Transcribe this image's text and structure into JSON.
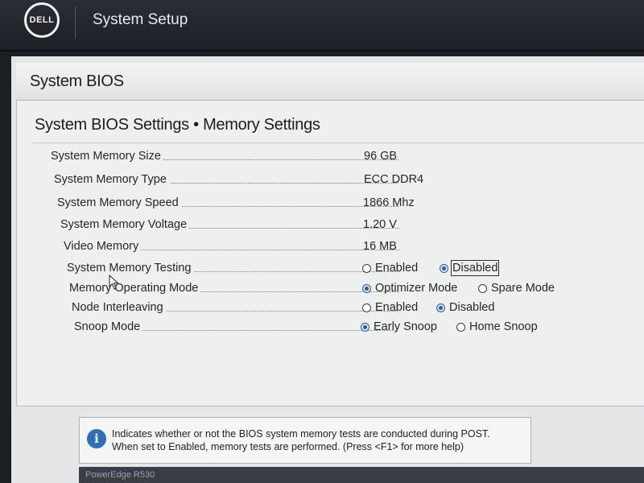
{
  "header": {
    "logo_text": "DELL",
    "app_title": "System Setup"
  },
  "bios": {
    "title": "System BIOS",
    "page_heading": "System BIOS Settings • Memory Settings"
  },
  "settings": [
    {
      "label": "System Memory Size",
      "value": "96 GB"
    },
    {
      "label": "System Memory Type",
      "value": "ECC DDR4"
    },
    {
      "label": "System Memory Speed",
      "value": "1866 Mhz"
    },
    {
      "label": "System Memory Voltage",
      "value": "1.20 V"
    },
    {
      "label": "Video Memory",
      "value": "16 MB"
    },
    {
      "label": "System Memory Testing",
      "options": [
        "Enabled",
        "Disabled"
      ],
      "selected": "Disabled"
    },
    {
      "label": "Memory Operating Mode",
      "options": [
        "Optimizer Mode",
        "Spare Mode"
      ],
      "selected": "Optimizer Mode"
    },
    {
      "label": "Node Interleaving",
      "options": [
        "Enabled",
        "Disabled"
      ],
      "selected": "Disabled"
    },
    {
      "label": "Snoop Mode",
      "options": [
        "Early Snoop",
        "Home Snoop"
      ],
      "selected": "Early Snoop"
    }
  ],
  "help": {
    "icon": "info-icon",
    "line1": "Indicates whether or not the BIOS system memory tests are conducted during POST.",
    "line2": "When set to Enabled, memory tests are performed. (Press <F1> for more help)"
  },
  "footer": {
    "model": "PowerEdge R530"
  },
  "colors": {
    "accent": "#2f6fb5",
    "radio_selected": "#2c5aa0",
    "panel_bg": "#eef0f0",
    "topbar_bg": "#1d2026"
  }
}
